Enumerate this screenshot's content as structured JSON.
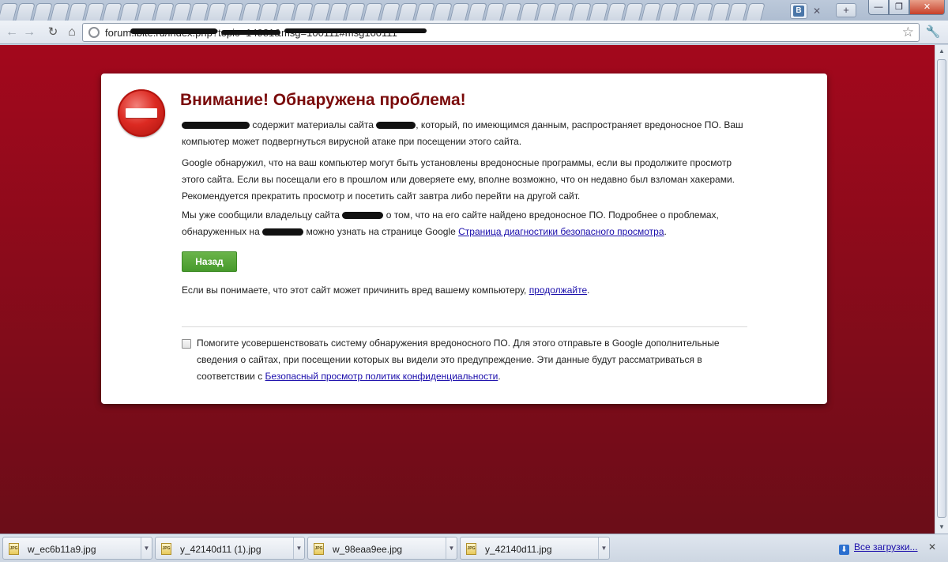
{
  "browser": {
    "url": "forum.ibite.ru/index.php?topic=14981&msg=100111#msg100111",
    "new_tab_label": "+",
    "window": {
      "min": "—",
      "max": "❐",
      "close": "✕"
    },
    "vk_tab_letter": "В"
  },
  "warning": {
    "title": "Внимание! Обнаружена проблема!",
    "para1": {
      "t1": "содержит материалы сайта",
      "t2": ", который, по имеющимся данным, распространяет вредоносное ПО. Ваш компьютер может подвергнуться вирусной атаке при посещении этого сайта."
    },
    "para2": "Google обнаружил, что на ваш компьютер могут быть установлены вредоносные программы, если вы продолжите просмотр этого сайта. Если вы посещали его в прошлом или доверяете ему, вполне возможно, что он недавно был взломан хакерами. Рекомендуется прекратить просмотр и посетить сайт завтра либо перейти на другой сайт.",
    "para3": {
      "t1": "Мы уже сообщили владельцу сайта",
      "t2": "о том, что на его сайте найдено вредоносное ПО. Подробнее о проблемах, обнаруженных на",
      "t3": "можно узнать на странице Google",
      "link": "Страница диагностики безопасного просмотра",
      "t4": "."
    },
    "back_button": "Назад",
    "proceed": {
      "text": "Если вы понимаете, что этот сайт может причинить вред вашему компьютеру,",
      "link": "продолжайте",
      "end": "."
    },
    "report": {
      "text": "Помогите усовершенствовать систему обнаружения вредоносного ПО. Для этого отправьте в Google дополнительные сведения о сайтах, при посещении которых вы видели это предупреждение. Эти данные будут рассматриваться в соответствии с",
      "link": "Безопасный просмотр политик конфиденциальности",
      "end": ".",
      "checked": false
    }
  },
  "downloads": {
    "items": [
      {
        "name": "w_ec6b11a9.jpg",
        "icon": "jpg-file-icon"
      },
      {
        "name": "y_42140d11 (1).jpg",
        "icon": "jpg-file-icon"
      },
      {
        "name": "w_98eaa9ee.jpg",
        "icon": "jpg-file-icon"
      },
      {
        "name": "y_42140d11.jpg",
        "icon": "jpg-file-icon"
      }
    ],
    "icon_label": "JPG",
    "all_label": "Все загрузки...",
    "close": "✕"
  },
  "colors": {
    "page_background": "#8a0b1b",
    "title": "#7a0a0a",
    "back_button": "#479a2c",
    "link": "#1a0dab"
  }
}
